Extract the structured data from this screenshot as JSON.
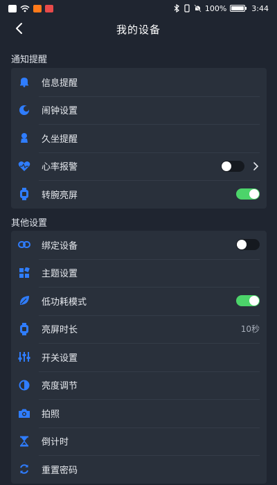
{
  "statusbar": {
    "battery": "100%",
    "time": "3:44"
  },
  "header": {
    "title": "我的设备"
  },
  "accent_color": "#2f7dff",
  "toggle_on_color": "#4cd46a",
  "sections": {
    "notifications": {
      "title": "通知提醒",
      "items": [
        {
          "label": "信息提醒",
          "icon": "bell-icon"
        },
        {
          "label": "闹钟设置",
          "icon": "alarm-moon-icon"
        },
        {
          "label": "久坐提醒",
          "icon": "sitting-person-icon"
        },
        {
          "label": "心率报警",
          "icon": "heart-rate-icon",
          "toggle": "off",
          "chevron": true
        },
        {
          "label": "转腕亮屏",
          "icon": "watch-icon",
          "toggle": "on"
        }
      ]
    },
    "other": {
      "title": "其他设置",
      "items": [
        {
          "label": "绑定设备",
          "icon": "link-icon",
          "toggle": "off"
        },
        {
          "label": "主题设置",
          "icon": "theme-grid-icon"
        },
        {
          "label": "低功耗模式",
          "icon": "leaf-icon",
          "toggle": "on"
        },
        {
          "label": "亮屏时长",
          "icon": "watch-screen-icon",
          "value": "10秒"
        },
        {
          "label": "开关设置",
          "icon": "sliders-icon"
        },
        {
          "label": "亮度调节",
          "icon": "brightness-icon"
        },
        {
          "label": "拍照",
          "icon": "camera-icon"
        },
        {
          "label": "倒计时",
          "icon": "hourglass-icon"
        },
        {
          "label": "重置密码",
          "icon": "reset-icon"
        }
      ]
    }
  }
}
